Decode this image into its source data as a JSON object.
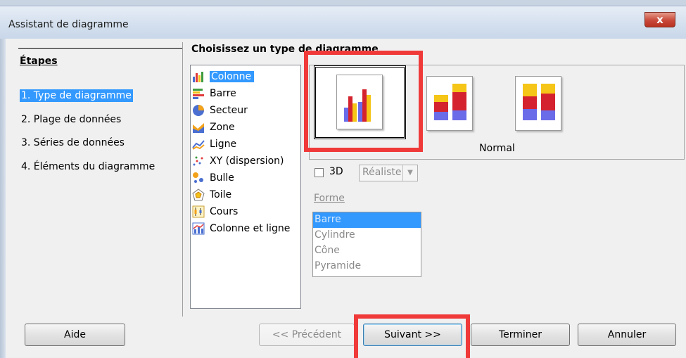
{
  "window": {
    "title": "Assistant de diagramme",
    "close_symbol": "x"
  },
  "steps": {
    "title": "Étapes",
    "items": [
      {
        "label": "1. Type de diagramme",
        "selected": true
      },
      {
        "label": "2. Plage de données"
      },
      {
        "label": "3. Séries de données"
      },
      {
        "label": "4. Éléments du diagramme"
      }
    ]
  },
  "main": {
    "heading": "Choisissez un type de diagramme",
    "chart_types": [
      {
        "label": "Colonne",
        "icon": "column-chart-icon",
        "selected": true
      },
      {
        "label": "Barre",
        "icon": "bar-chart-icon"
      },
      {
        "label": "Secteur",
        "icon": "pie-chart-icon"
      },
      {
        "label": "Zone",
        "icon": "area-chart-icon"
      },
      {
        "label": "Ligne",
        "icon": "line-chart-icon"
      },
      {
        "label": "XY (dispersion)",
        "icon": "scatter-chart-icon"
      },
      {
        "label": "Bulle",
        "icon": "bubble-chart-icon"
      },
      {
        "label": "Toile",
        "icon": "net-chart-icon"
      },
      {
        "label": "Cours",
        "icon": "stock-chart-icon"
      },
      {
        "label": "Colonne et ligne",
        "icon": "column-line-chart-icon"
      }
    ],
    "variant_label": "Normal",
    "three_d_label": "3D",
    "three_d_checked": false,
    "three_d_style": "Réaliste",
    "shape_label": "Forme",
    "shapes": [
      "Barre",
      "Cylindre",
      "Cône",
      "Pyramide"
    ],
    "selected_shape": "Barre"
  },
  "buttons": {
    "help": "Aide",
    "previous": "<< Précédent",
    "next": "Suivant >>",
    "finish": "Terminer",
    "cancel": "Annuler"
  },
  "colors": {
    "selection": "#3399ff",
    "highlight": "#f03a3a"
  }
}
